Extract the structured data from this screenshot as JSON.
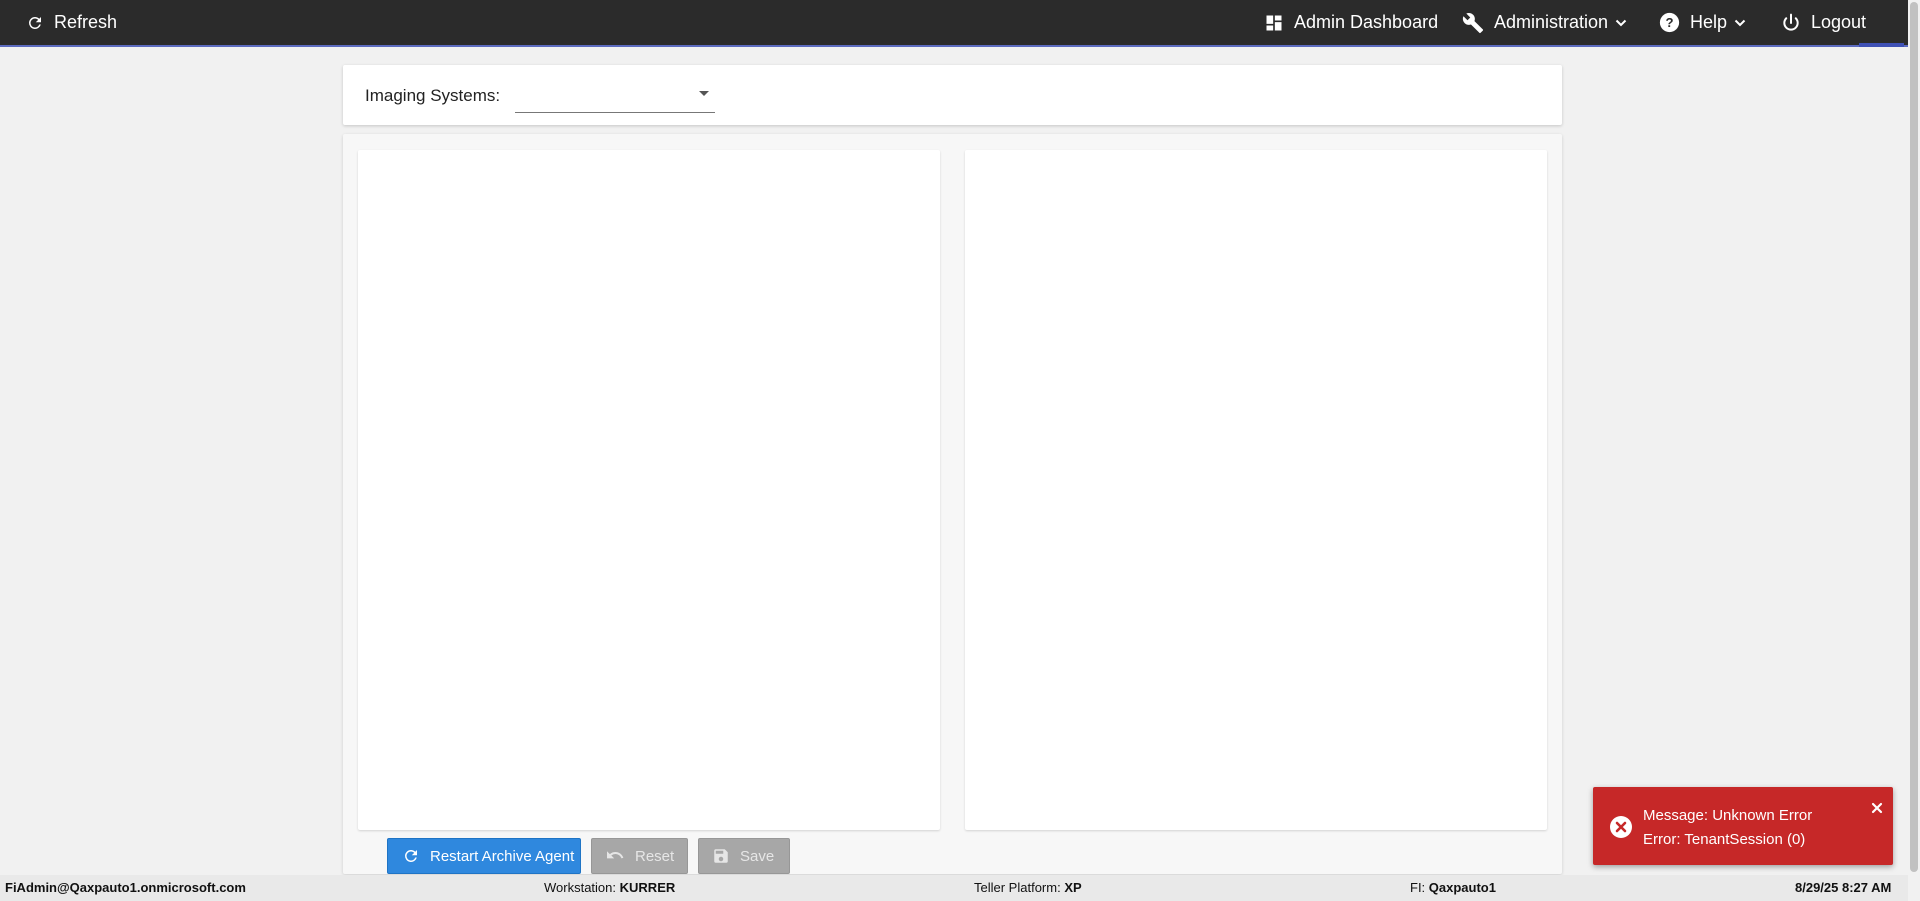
{
  "topbar": {
    "refresh_label": "Refresh",
    "admin_dashboard_label": "Admin Dashboard",
    "administration_label": "Administration",
    "help_label": "Help",
    "logout_label": "Logout"
  },
  "filter": {
    "imaging_systems_label": "Imaging Systems:",
    "imaging_systems_value": ""
  },
  "actions": {
    "restart_label": "Restart Archive Agent",
    "reset_label": "Reset",
    "save_label": "Save"
  },
  "status": {
    "user": "FiAdmin@Qaxpauto1.onmicrosoft.com",
    "workstation_label": "Workstation:",
    "workstation_value": "KURRER",
    "teller_label": "Teller Platform:",
    "teller_value": "XP",
    "fi_label": "FI:",
    "fi_value": "Qaxpauto1",
    "datetime": "8/29/25 8:27 AM"
  },
  "toast": {
    "line1": "Message: Unknown Error",
    "line2": "Error: TenantSession (0)"
  },
  "colors": {
    "topbar": "#2b2b2b",
    "primary_button": "#2f88de",
    "error_toast": "#c62828",
    "disabled_button": "#a7a7a7"
  },
  "icons": [
    "refresh-icon",
    "dashboard-icon",
    "wrench-icon",
    "help-icon",
    "power-icon",
    "chevron-down-icon",
    "undo-icon",
    "save-icon",
    "error-icon",
    "close-icon"
  ]
}
